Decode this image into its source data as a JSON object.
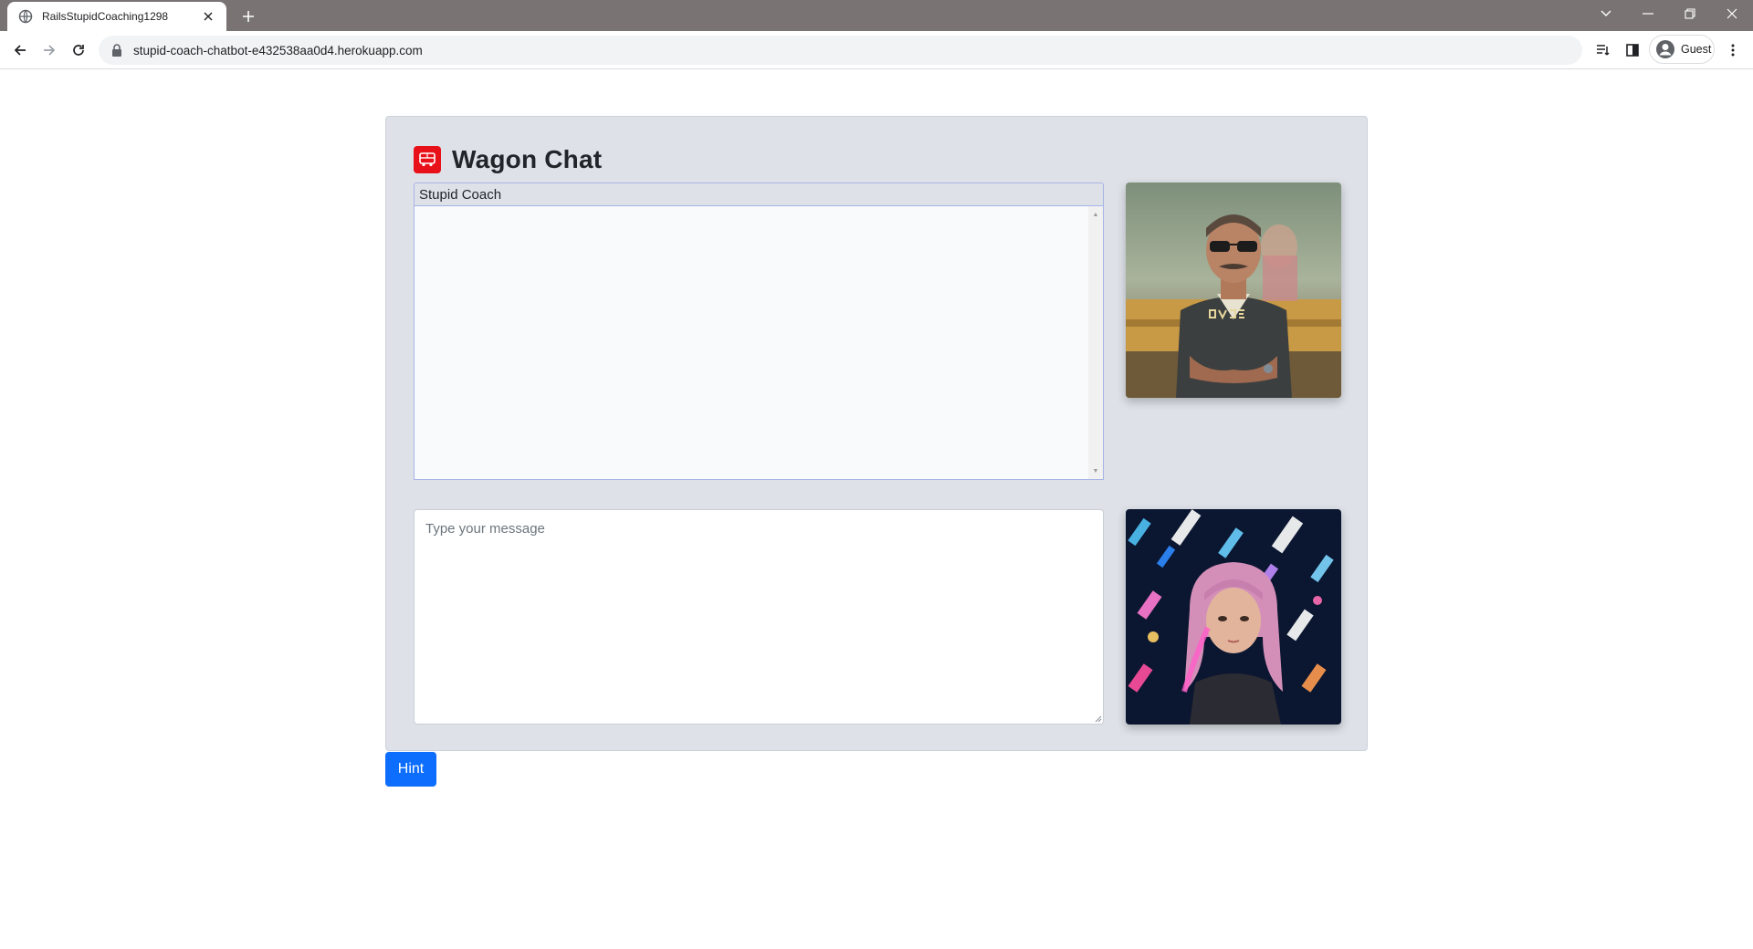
{
  "browser": {
    "tab_title": "RailsStupidCoaching1298",
    "url": "stupid-coach-chatbot-e432538aa0d4.herokuapp.com",
    "profile_label": "Guest",
    "tabstrip_color": "#7a7374"
  },
  "page": {
    "app_title": "Wagon Chat",
    "chat_label": "Stupid Coach",
    "message_placeholder": "Type your message",
    "message_value": "",
    "hint_label": "Hint",
    "accent_color": "#0d6efd",
    "logo_color": "#e8111a"
  },
  "icons": {
    "logo": "bus-icon",
    "coach_avatar": "coach-avatar-image",
    "user_avatar": "user-avatar-image"
  }
}
